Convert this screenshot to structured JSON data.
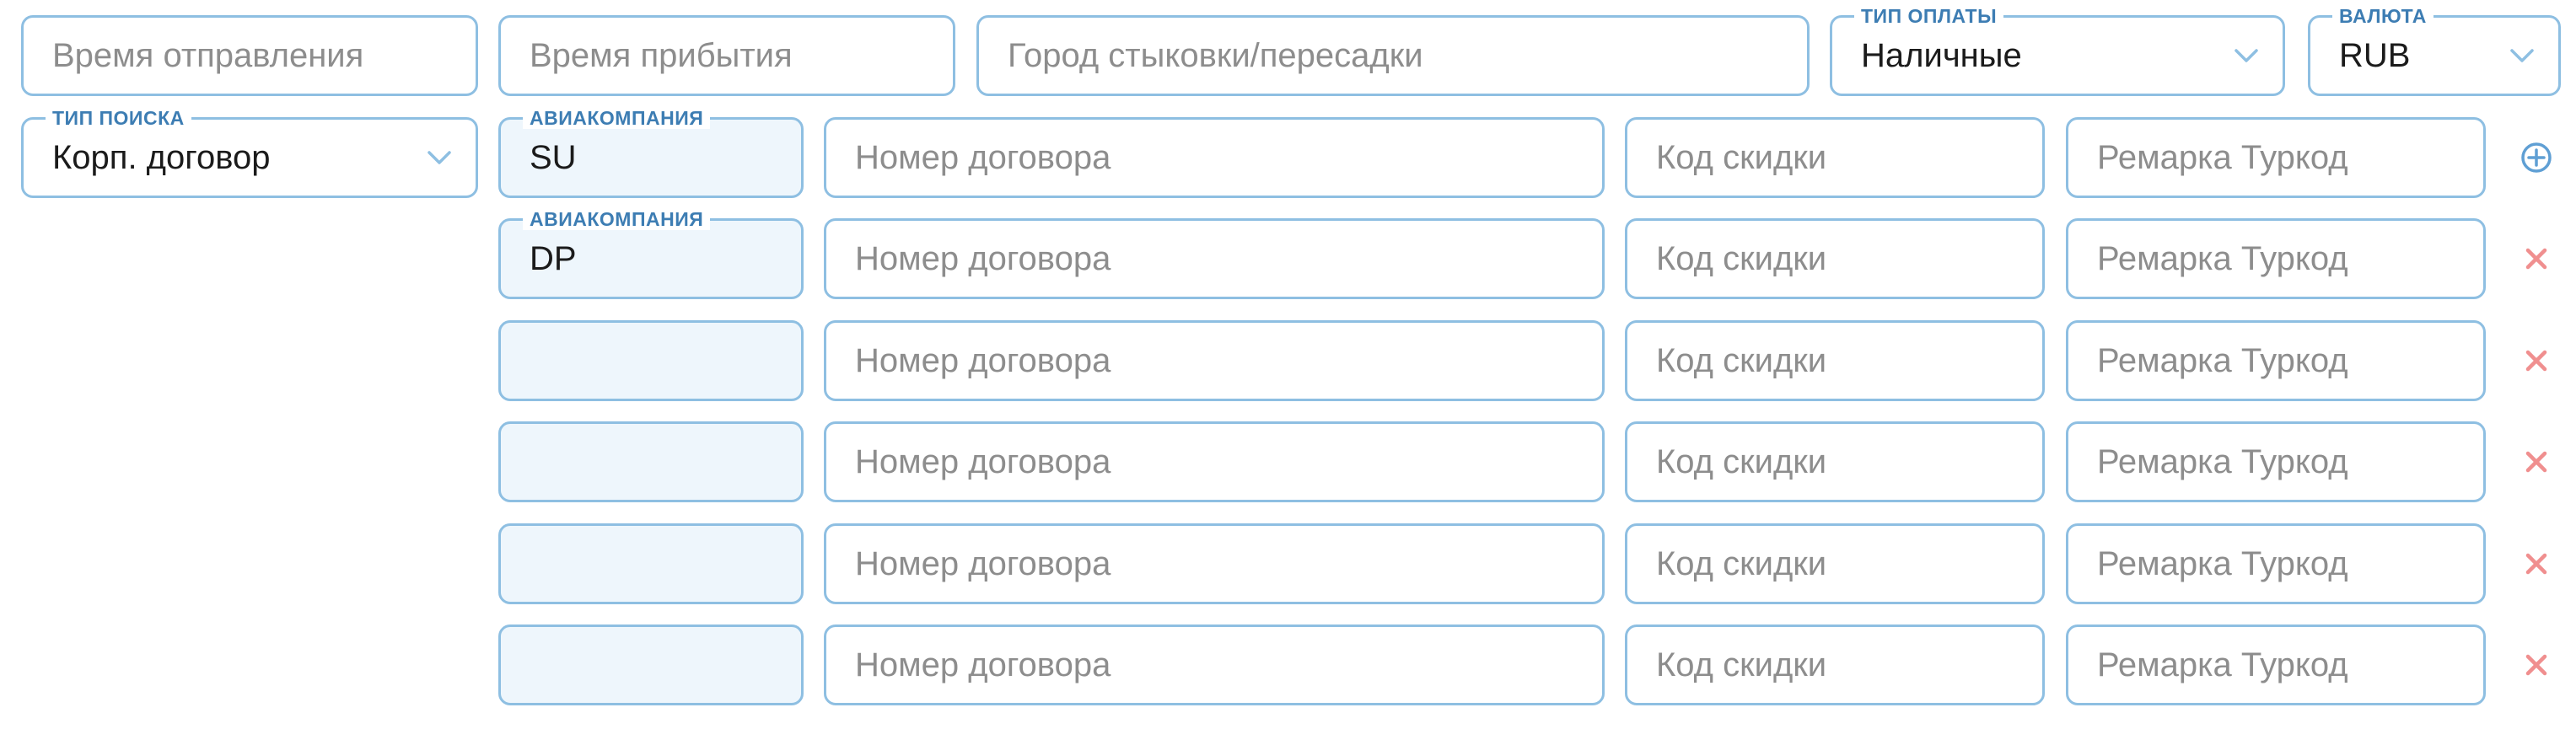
{
  "top_row": {
    "departure_time": {
      "placeholder": "Время отправления",
      "value": ""
    },
    "arrival_time": {
      "placeholder": "Время прибытия",
      "value": ""
    },
    "connection_city": {
      "placeholder": "Город стыковки/пересадки",
      "value": ""
    },
    "payment_type": {
      "label": "ТИП ОПЛАТЫ",
      "value": "Наличные"
    },
    "currency": {
      "label": "ВАЛЮТА",
      "value": "RUB"
    }
  },
  "search_type": {
    "label": "ТИП ПОИСКА",
    "value": "Корп. договор"
  },
  "contracts": {
    "airline_label": "АВИАКОМПАНИЯ",
    "contract_number_placeholder": "Номер договора",
    "discount_code_placeholder": "Код скидки",
    "tourcode_remark_placeholder": "Ремарка Туркод",
    "rows": [
      {
        "airline": "SU",
        "contract_number": "",
        "discount_code": "",
        "tourcode_remark": "",
        "action": "add-circle-icon"
      },
      {
        "airline": "DP",
        "contract_number": "",
        "discount_code": "",
        "tourcode_remark": "",
        "action": "remove-icon"
      },
      {
        "airline": "",
        "contract_number": "",
        "discount_code": "",
        "tourcode_remark": "",
        "action": "remove-icon"
      },
      {
        "airline": "",
        "contract_number": "",
        "discount_code": "",
        "tourcode_remark": "",
        "action": "remove-icon"
      },
      {
        "airline": "",
        "contract_number": "",
        "discount_code": "",
        "tourcode_remark": "",
        "action": "remove-icon"
      },
      {
        "airline": "",
        "contract_number": "",
        "discount_code": "",
        "tourcode_remark": "",
        "action": "remove-icon"
      }
    ]
  },
  "colors": {
    "border": "#8ebfe2",
    "legend_text": "#3d7db3",
    "airline_fill": "#eef6fc",
    "add_icon": "#5f9fd4",
    "remove_icon": "#f08f8f",
    "placeholder": "#8d8d8d",
    "value_text": "#1b1b1b"
  }
}
